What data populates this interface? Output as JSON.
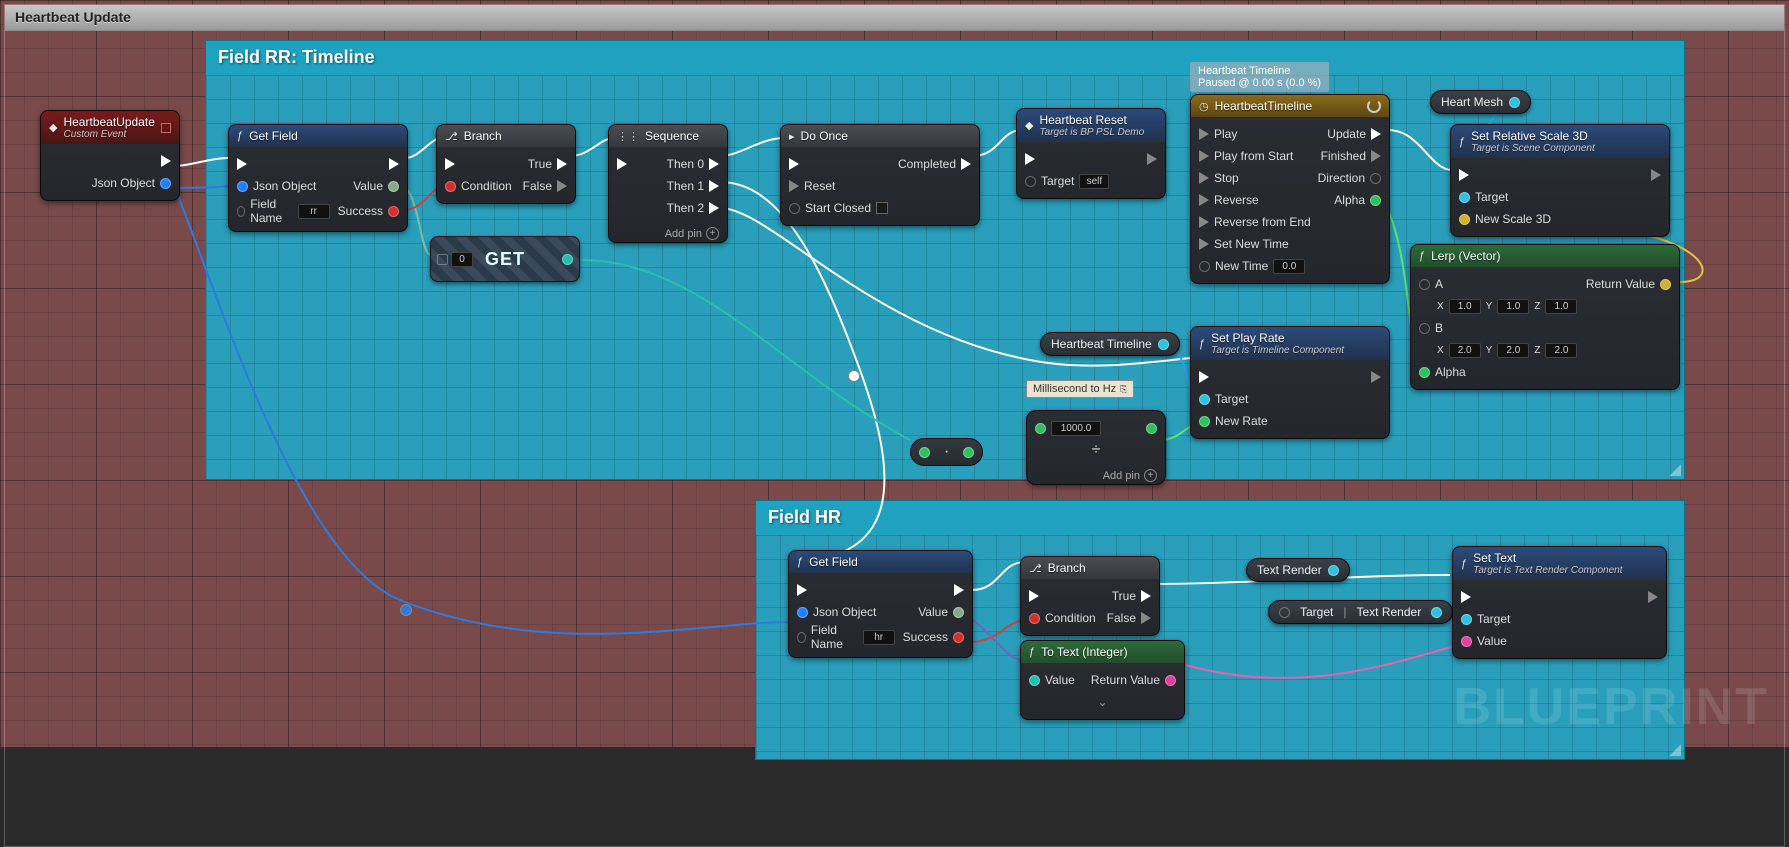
{
  "watermark": "BLUEPRINT",
  "outerTitle": "Heartbeat Update",
  "sections": {
    "rr": {
      "title": "Field RR: Timeline"
    },
    "hr": {
      "title": "Field HR"
    }
  },
  "timelineTip": {
    "line1": "Heartbeat Timeline",
    "line2": "Paused @ 0.00 s (0.0 %)"
  },
  "tooltip": {
    "label": "Millisecond to Hz"
  },
  "pills": {
    "heartMesh": "Heart Mesh",
    "heartbeatTimeline": "Heartbeat Timeline",
    "textRender": "Text Render",
    "target": "Target",
    "textRender2": "Text Render"
  },
  "nodes": {
    "event": {
      "title": "HeartbeatUpdate",
      "sub": "Custom Event",
      "out": "Json Object"
    },
    "getField1": {
      "title": "Get Field",
      "pins": {
        "json": "Json Object",
        "fieldName": "Field Name",
        "value": "Value",
        "success": "Success"
      },
      "fieldInput": "rr"
    },
    "branch1": {
      "title": "Branch",
      "condition": "Condition",
      "true": "True",
      "false": "False"
    },
    "sequence": {
      "title": "Sequence",
      "then0": "Then 0",
      "then1": "Then 1",
      "then2": "Then 2",
      "addPin": "Add pin"
    },
    "doOnce": {
      "title": "Do Once",
      "reset": "Reset",
      "startClosed": "Start Closed",
      "completed": "Completed"
    },
    "heartbeatReset": {
      "title": "Heartbeat Reset",
      "sub": "Target is BP PSL Demo",
      "target": "Target",
      "self": "self"
    },
    "timeline": {
      "title": "HeartbeatTimeline",
      "play": "Play",
      "playFromStart": "Play from Start",
      "stop": "Stop",
      "reverse": "Reverse",
      "reverseFromEnd": "Reverse from End",
      "setNewTime": "Set New Time",
      "newTime": "New Time",
      "newTimeVal": "0.0",
      "update": "Update",
      "finished": "Finished",
      "direction": "Direction",
      "alpha": "Alpha"
    },
    "setPlayRate": {
      "title": "Set Play Rate",
      "sub": "Target is Timeline Component",
      "target": "Target",
      "newRate": "New Rate"
    },
    "setScale": {
      "title": "Set Relative Scale 3D",
      "sub": "Target is Scene Component",
      "target": "Target",
      "newScale": "New Scale 3D"
    },
    "lerp": {
      "title": "Lerp (Vector)",
      "a": "A",
      "b": "B",
      "alpha": "Alpha",
      "ret": "Return Value",
      "ax": "1.0",
      "ay": "1.0",
      "az": "1.0",
      "bx": "2.0",
      "by": "2.0",
      "bz": "2.0"
    },
    "get": {
      "label": "GET",
      "idx": "0"
    },
    "mathDiv": {
      "input": "1000.0",
      "addPin": "Add pin"
    },
    "getField2": {
      "title": "Get Field",
      "pins": {
        "json": "Json Object",
        "fieldName": "Field Name",
        "value": "Value",
        "success": "Success"
      },
      "fieldInput": "hr"
    },
    "branch2": {
      "title": "Branch",
      "condition": "Condition",
      "true": "True",
      "false": "False"
    },
    "toText": {
      "title": "To Text (Integer)",
      "value": "Value",
      "ret": "Return Value"
    },
    "setText": {
      "title": "Set Text",
      "sub": "Target is Text Render Component",
      "target": "Target",
      "value": "Value"
    }
  }
}
